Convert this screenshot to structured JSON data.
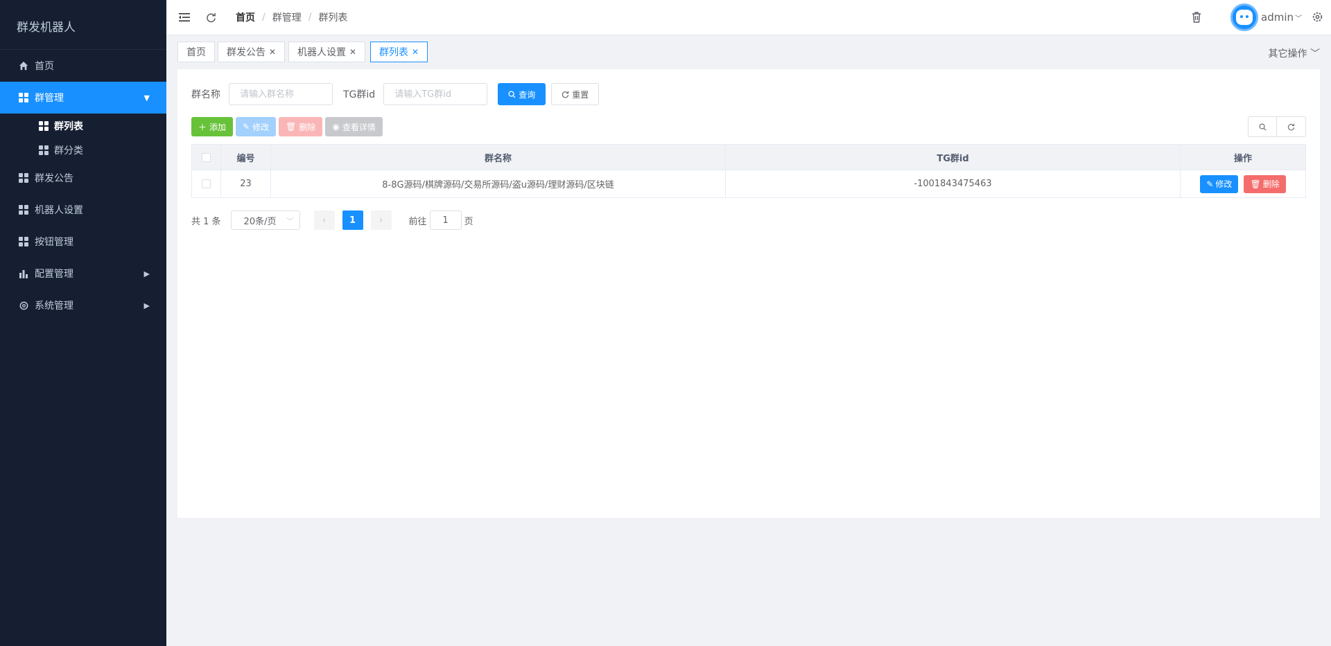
{
  "app": {
    "title": "群发机器人"
  },
  "sidebar": {
    "items": [
      {
        "label": "首页",
        "icon": "home-icon"
      },
      {
        "label": "群管理",
        "icon": "grid-icon",
        "active": true,
        "expanded": true,
        "children": [
          {
            "label": "群列表",
            "active": true
          },
          {
            "label": "群分类"
          }
        ]
      },
      {
        "label": "群发公告",
        "icon": "grid-icon"
      },
      {
        "label": "机器人设置",
        "icon": "grid-icon"
      },
      {
        "label": "按钮管理",
        "icon": "grid-icon"
      },
      {
        "label": "配置管理",
        "icon": "bar-chart-icon",
        "has_children": true
      },
      {
        "label": "系统管理",
        "icon": "gear-icon",
        "has_children": true
      }
    ]
  },
  "header": {
    "breadcrumb": [
      "首页",
      "群管理",
      "群列表"
    ],
    "separator": "/",
    "username": "admin"
  },
  "tags": [
    {
      "label": "首页"
    },
    {
      "label": "群发公告",
      "closable": true
    },
    {
      "label": "机器人设置",
      "closable": true
    },
    {
      "label": "群列表",
      "closable": true,
      "active": true
    }
  ],
  "other_ops": "其它操作",
  "search": {
    "group_name_label": "群名称",
    "group_name_placeholder": "请输入群名称",
    "tg_id_label": "TG群id",
    "tg_id_placeholder": "请输入TG群id",
    "query_label": "查询",
    "reset_label": "重置"
  },
  "toolbar": {
    "add": "添加",
    "edit": "修改",
    "delete": "删除",
    "view": "查看详情"
  },
  "table": {
    "columns": [
      "编号",
      "群名称",
      "TG群id",
      "操作"
    ],
    "rows": [
      {
        "id": "23",
        "name": "8-8G源码/棋牌源码/交易所源码/盗u源码/理财源码/区块链",
        "tg_id": "-1001843475463"
      }
    ],
    "row_edit": "修改",
    "row_delete": "删除"
  },
  "pagination": {
    "total_text": "共 1 条",
    "page_size": "20条/页",
    "current_page": "1",
    "goto_label": "前往",
    "goto_value": "1",
    "page_suffix": "页"
  },
  "colors": {
    "sidebar_bg": "#151f31",
    "primary": "#1890ff",
    "success": "#67c23a",
    "danger": "#f56c6c"
  }
}
